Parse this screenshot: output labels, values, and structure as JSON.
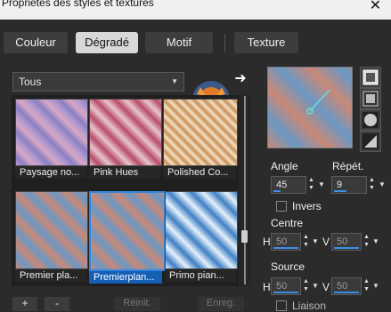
{
  "window": {
    "title": "Propriétés des styles et textures",
    "close_glyph": "✕"
  },
  "tabs": [
    {
      "label": "Couleur"
    },
    {
      "label": "Dégradé",
      "active": true
    },
    {
      "label": "Motif"
    },
    {
      "label": "Texture"
    }
  ],
  "filter": {
    "value": "Tous",
    "dropdown_glyph": "▼"
  },
  "next_glyph": "➜",
  "gallery": {
    "items": [
      {
        "label": "Paysage no..."
      },
      {
        "label": "Pink Hues"
      },
      {
        "label": "Polished Co..."
      },
      {
        "label": "Premier pla..."
      },
      {
        "label": "Premierplan...",
        "selected": true
      },
      {
        "label": "Primo pian..."
      }
    ]
  },
  "buttons": {
    "add": "+",
    "remove": "-",
    "reset": "Réinit.",
    "save": "Enreg."
  },
  "options": {
    "angle_label": "Angle",
    "angle_value": "45",
    "repeat_label": "Répét.",
    "repeat_value": "9",
    "invert_label": "Invers",
    "center_label": "Centre",
    "source_label": "Source",
    "h_label": "H",
    "v_label": "V",
    "center_h": "50",
    "center_v": "50",
    "source_h": "50",
    "source_v": "50",
    "lock_label": "Liaison"
  },
  "colors": {
    "accent": "#2f86e0",
    "grad_a": "#c98977",
    "grad_b": "#6b98c4"
  }
}
